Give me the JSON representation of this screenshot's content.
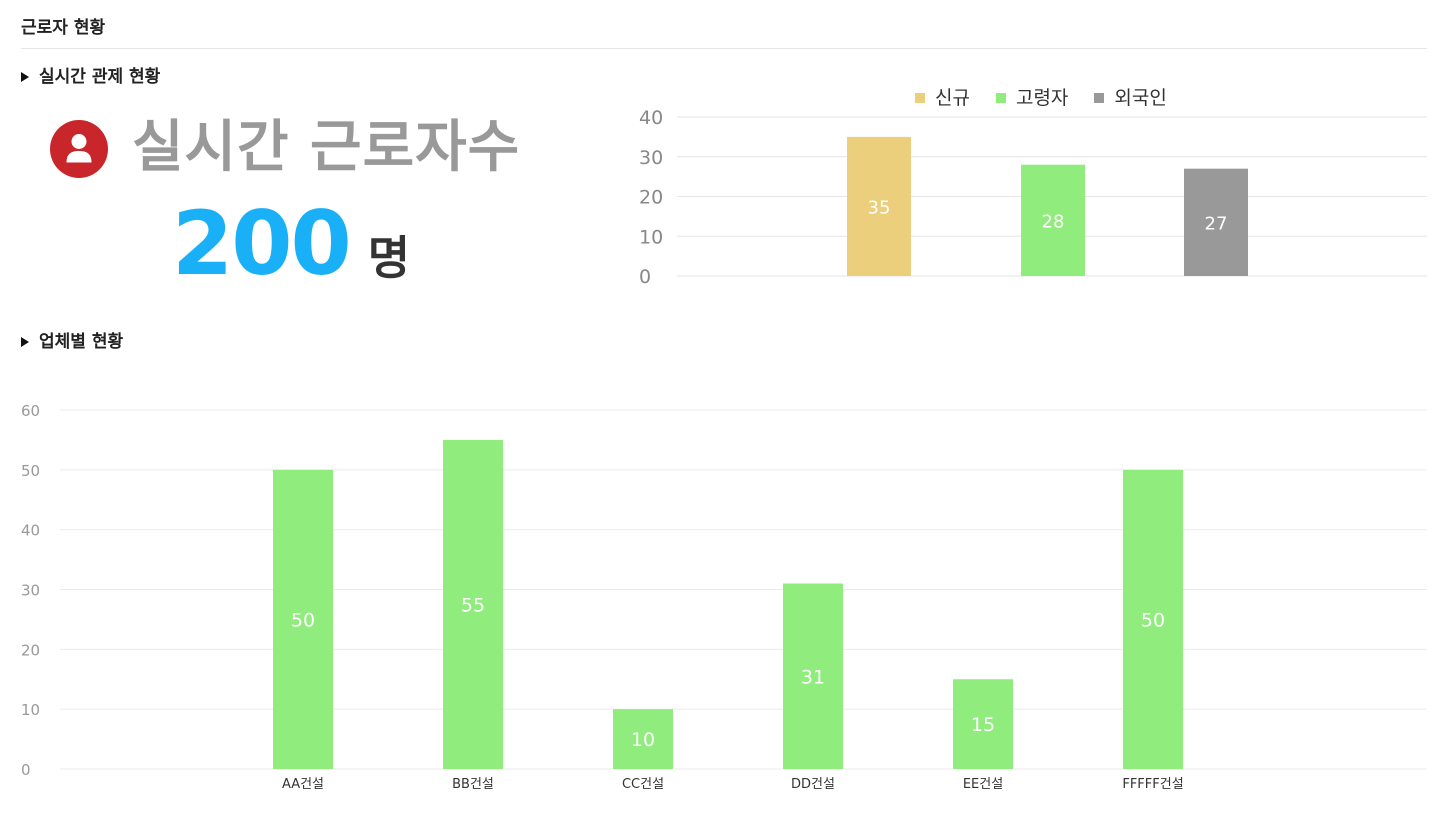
{
  "page": {
    "title": "근로자 현황"
  },
  "live_section": {
    "heading": "실시간 관제 현황",
    "icon": "user-icon",
    "badge_color": "#c9262c",
    "label": "실시간 근로자수",
    "count": "200",
    "unit": "명"
  },
  "company_section": {
    "heading": "업체별 현황"
  },
  "chart_data": [
    {
      "type": "bar",
      "categories": [
        "신규",
        "고령자",
        "외국인"
      ],
      "values": [
        35,
        28,
        27
      ],
      "colors": [
        "#ebcf7d",
        "#90ec7d",
        "#999999"
      ],
      "legend": [
        "신규",
        "고령자",
        "외국인"
      ],
      "legend_position": "top",
      "ylim": [
        0,
        40
      ],
      "yticks": [
        0,
        10,
        20,
        30,
        40
      ],
      "grid": true,
      "data_labels": true
    },
    {
      "type": "bar",
      "categories": [
        "AA건설",
        "BB건설",
        "CC건설",
        "DD건설",
        "EE건설",
        "FFFFF건설"
      ],
      "values": [
        50,
        55,
        10,
        31,
        15,
        50
      ],
      "color": "#90ec7d",
      "ylim": [
        0,
        60
      ],
      "yticks": [
        0,
        10,
        20,
        30,
        40,
        50,
        60
      ],
      "grid": true,
      "data_labels": true
    }
  ]
}
